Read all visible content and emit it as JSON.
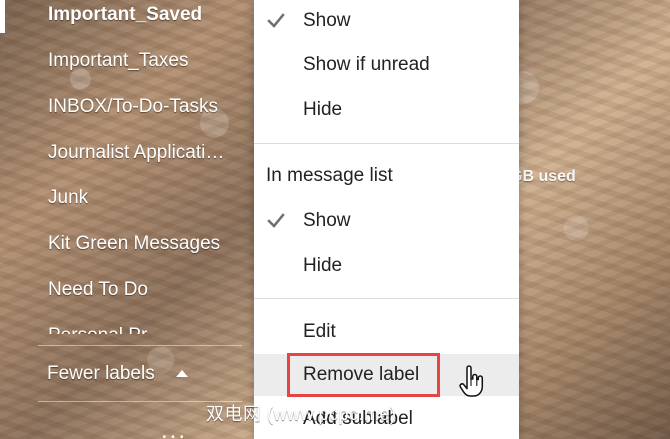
{
  "sidebar": {
    "labels": [
      "Important_Saved",
      "Important_Taxes",
      "INBOX/To-Do-Tasks",
      "Journalist Applicati…",
      "Junk",
      "Kit Green Messages",
      "Need To Do",
      "Personal Pr..."
    ],
    "fewer_labels": "Fewer labels",
    "more_dots": "..."
  },
  "storage": {
    "text": "GB used"
  },
  "menu": {
    "label_list_show": "Show",
    "label_list_show_if_unread": "Show if unread",
    "label_list_hide": "Hide",
    "message_list_heading": "In message list",
    "message_list_show": "Show",
    "message_list_hide": "Hide",
    "edit": "Edit",
    "remove_label": "Remove label",
    "add_sublabel": "Add sublabel"
  },
  "watermark": {
    "text": "双电网 (www.pcpc.me)"
  },
  "colors": {
    "menu_bg": "#ffffff",
    "menu_text": "#222222",
    "hover_bg": "#ececec",
    "highlight_border": "#e64545",
    "sidebar_text": "#ffffff"
  },
  "icons": {
    "check": "check-icon",
    "caret": "caret-up-icon",
    "cursor": "hand-pointer-icon"
  }
}
